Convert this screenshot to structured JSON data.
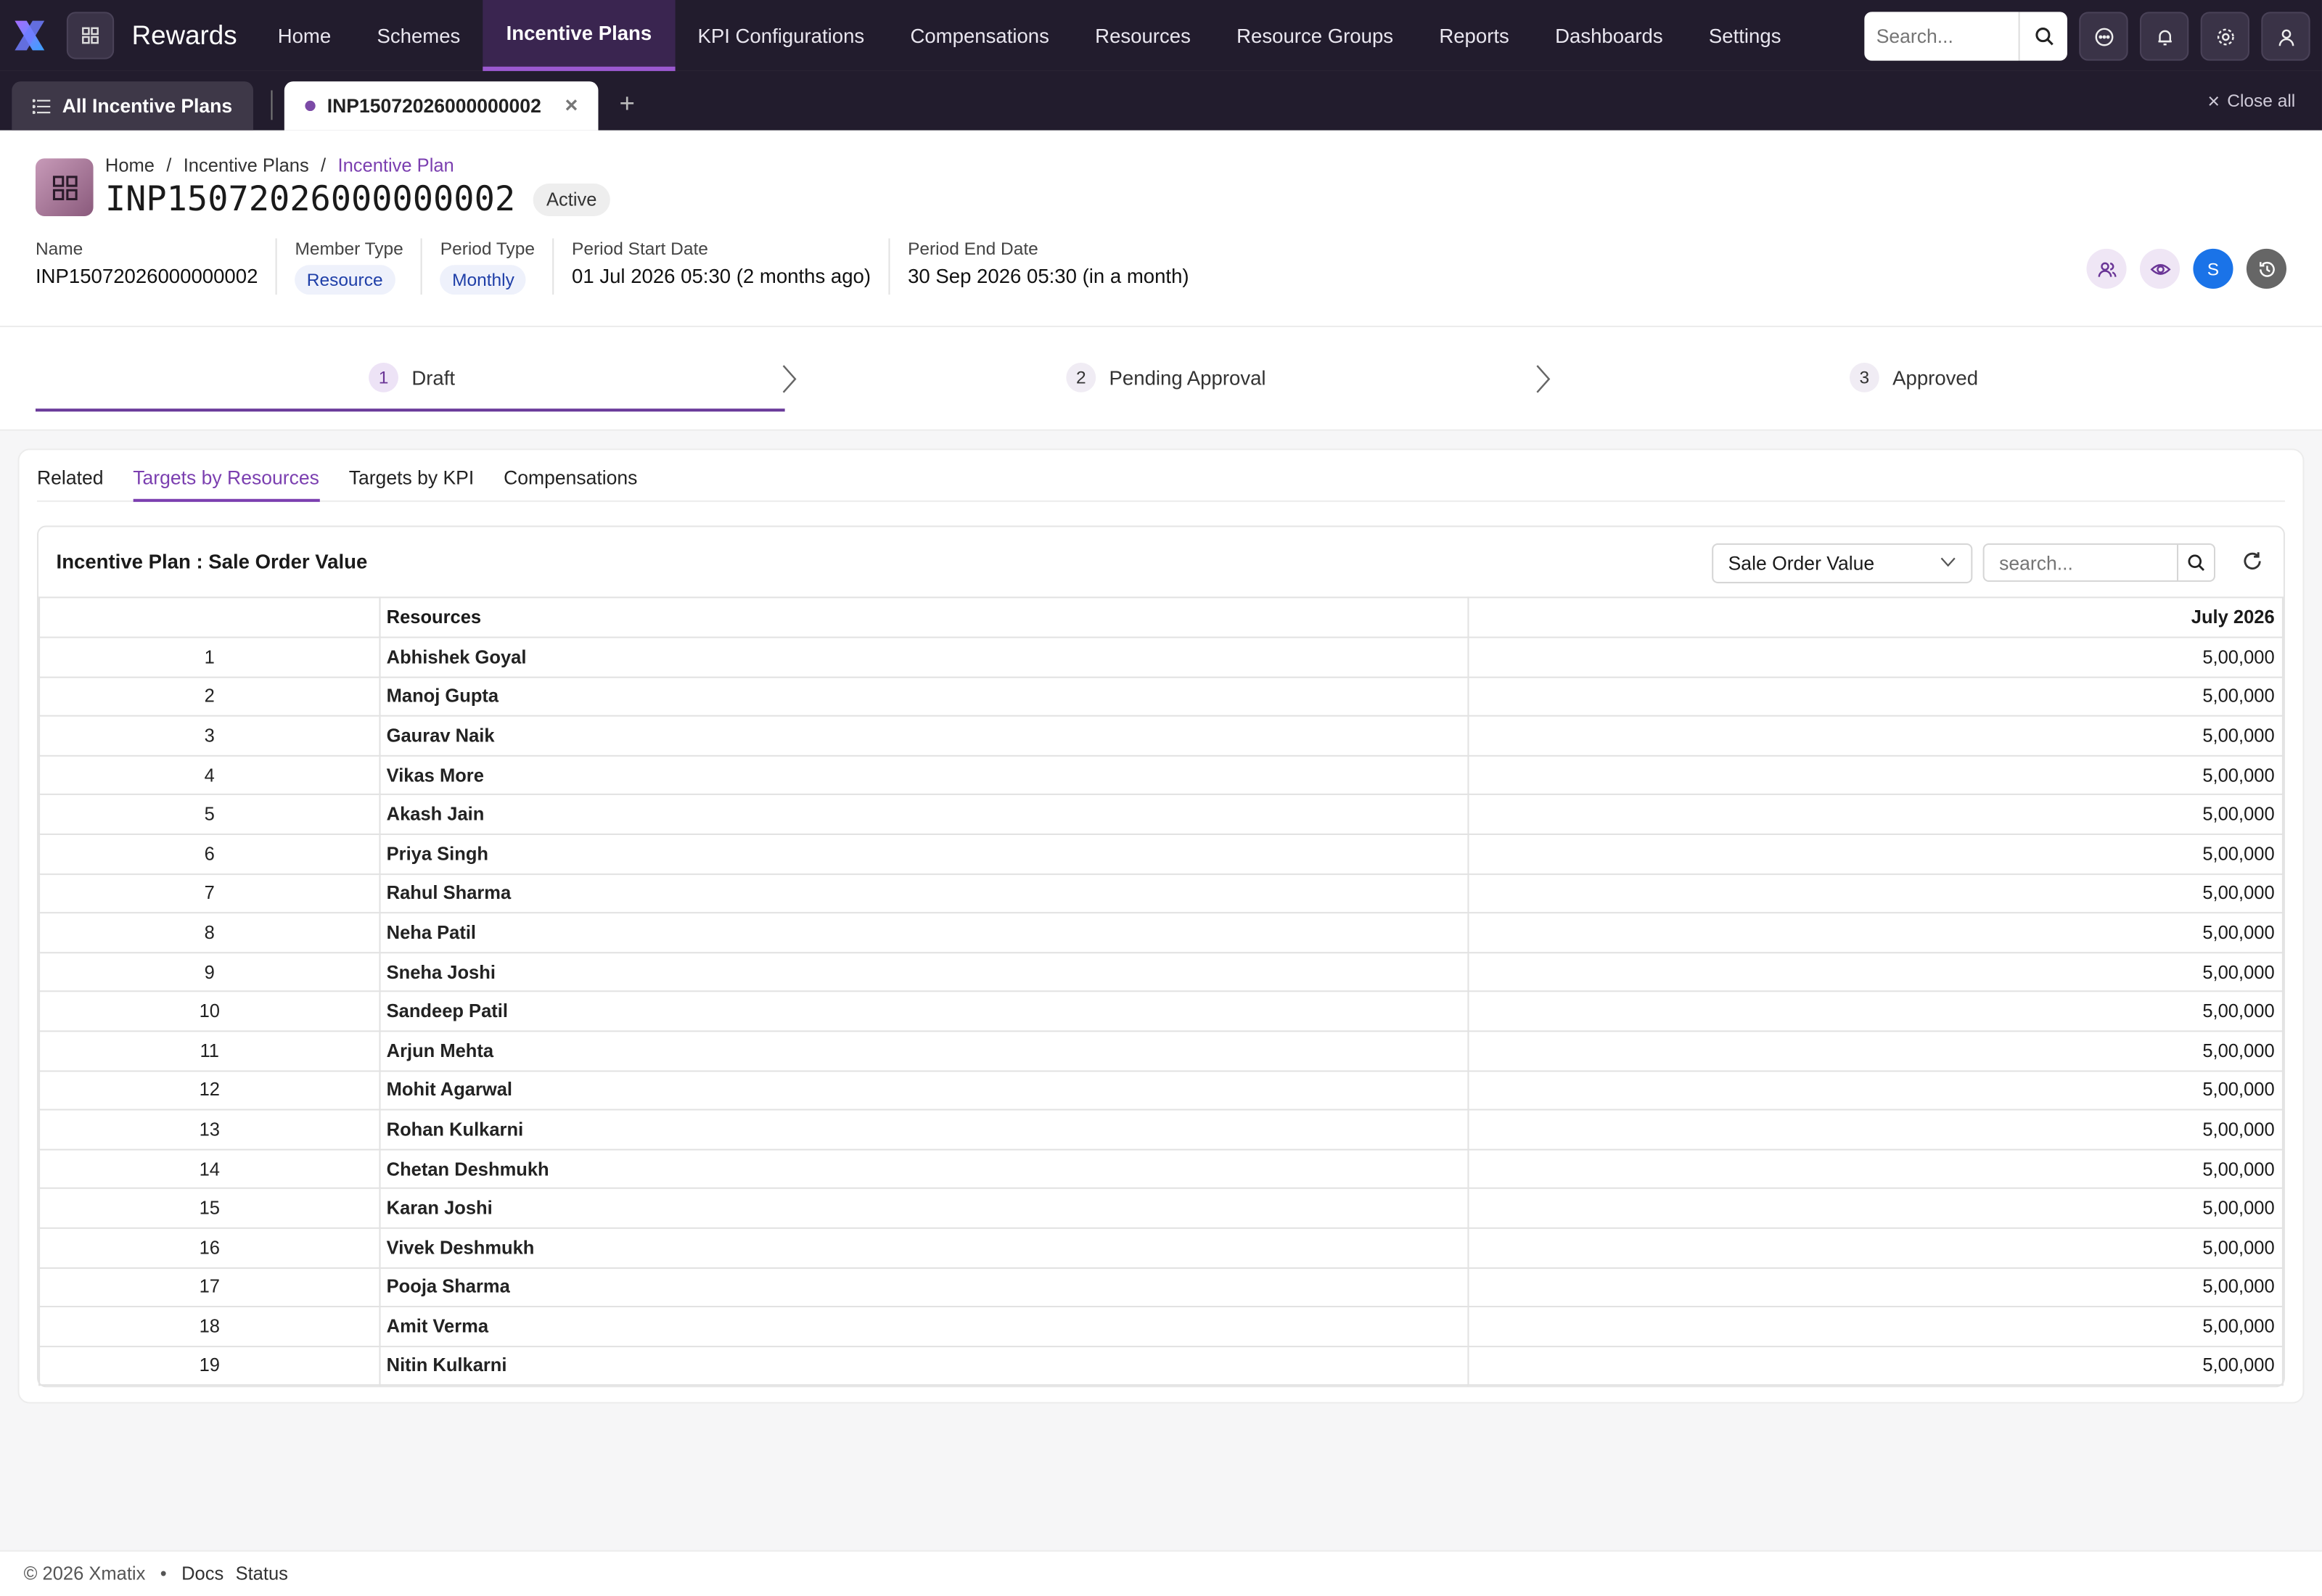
{
  "app": {
    "brand": "Rewards"
  },
  "nav": {
    "items": [
      {
        "label": "Home"
      },
      {
        "label": "Schemes"
      },
      {
        "label": "Incentive Plans"
      },
      {
        "label": "KPI Configurations"
      },
      {
        "label": "Compensations"
      },
      {
        "label": "Resources"
      },
      {
        "label": "Resource Groups"
      },
      {
        "label": "Reports"
      },
      {
        "label": "Dashboards"
      },
      {
        "label": "Settings"
      }
    ],
    "active": "Incentive Plans",
    "search_placeholder": "Search..."
  },
  "tabs": {
    "all_label": "All Incentive Plans",
    "open_label": "INP15072026000000002",
    "close_all": "Close all"
  },
  "header": {
    "breadcrumbs": [
      "Home",
      "Incentive Plans",
      "Incentive Plan"
    ],
    "title": "INP15072026000000002",
    "status": "Active",
    "fields": {
      "name_label": "Name",
      "name_value": "INP15072026000000002",
      "member_type_label": "Member Type",
      "member_type_value": "Resource",
      "period_type_label": "Period Type",
      "period_type_value": "Monthly",
      "start_label": "Period Start Date",
      "start_value": "01 Jul 2026 05:30 (2 months ago)",
      "end_label": "Period End Date",
      "end_value": "30 Sep 2026 05:30 (in a month)"
    },
    "avatar_initial": "S"
  },
  "stepper": {
    "steps": [
      {
        "num": "1",
        "label": "Draft"
      },
      {
        "num": "2",
        "label": "Pending Approval"
      },
      {
        "num": "3",
        "label": "Approved"
      }
    ],
    "active": "Draft"
  },
  "content_tabs": {
    "items": [
      {
        "label": "Related"
      },
      {
        "label": "Targets by Resources"
      },
      {
        "label": "Targets by KPI"
      },
      {
        "label": "Compensations"
      }
    ],
    "active": "Targets by Resources"
  },
  "panel": {
    "title": "Incentive Plan : Sale Order Value",
    "kpi_selected": "Sale Order Value",
    "search_placeholder": "search...",
    "columns": [
      "",
      "Resources",
      "July 2026"
    ],
    "rows": [
      {
        "idx": "1",
        "name": "Abhishek Goyal",
        "value": "5,00,000"
      },
      {
        "idx": "2",
        "name": "Manoj Gupta",
        "value": "5,00,000"
      },
      {
        "idx": "3",
        "name": "Gaurav Naik",
        "value": "5,00,000"
      },
      {
        "idx": "4",
        "name": "Vikas More",
        "value": "5,00,000"
      },
      {
        "idx": "5",
        "name": "Akash Jain",
        "value": "5,00,000"
      },
      {
        "idx": "6",
        "name": "Priya Singh",
        "value": "5,00,000"
      },
      {
        "idx": "7",
        "name": "Rahul Sharma",
        "value": "5,00,000"
      },
      {
        "idx": "8",
        "name": "Neha Patil",
        "value": "5,00,000"
      },
      {
        "idx": "9",
        "name": "Sneha Joshi",
        "value": "5,00,000"
      },
      {
        "idx": "10",
        "name": "Sandeep Patil",
        "value": "5,00,000"
      },
      {
        "idx": "11",
        "name": "Arjun Mehta",
        "value": "5,00,000"
      },
      {
        "idx": "12",
        "name": "Mohit Agarwal",
        "value": "5,00,000"
      },
      {
        "idx": "13",
        "name": "Rohan Kulkarni",
        "value": "5,00,000"
      },
      {
        "idx": "14",
        "name": "Chetan Deshmukh",
        "value": "5,00,000"
      },
      {
        "idx": "15",
        "name": "Karan Joshi",
        "value": "5,00,000"
      },
      {
        "idx": "16",
        "name": "Vivek Deshmukh",
        "value": "5,00,000"
      },
      {
        "idx": "17",
        "name": "Pooja Sharma",
        "value": "5,00,000"
      },
      {
        "idx": "18",
        "name": "Amit Verma",
        "value": "5,00,000"
      },
      {
        "idx": "19",
        "name": "Nitin Kulkarni",
        "value": "5,00,000"
      }
    ]
  },
  "footer": {
    "copyright": "© 2026 Xmatix",
    "bullet": "•",
    "links": [
      "Docs",
      "Status"
    ]
  },
  "colors": {
    "nav_bg": "#221c2d",
    "accent": "#7b3fb0",
    "pill_text": "#1f3fa8",
    "avatar_bg": "#1a73e8"
  }
}
